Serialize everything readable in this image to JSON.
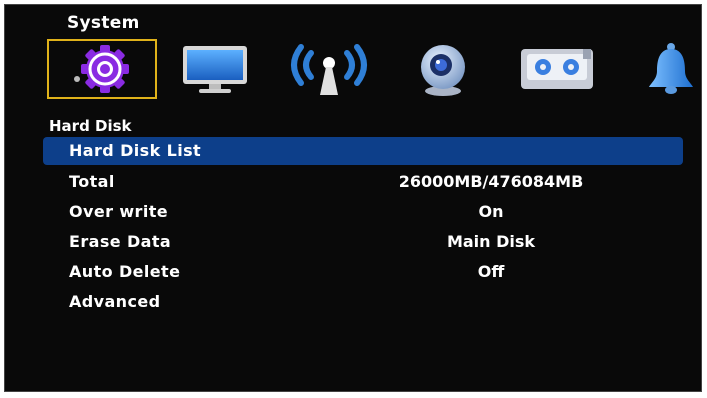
{
  "header": {
    "title": "System"
  },
  "tabs": [
    {
      "name": "system",
      "icon": "gear-icon",
      "selected": true
    },
    {
      "name": "display",
      "icon": "monitor-icon",
      "selected": false
    },
    {
      "name": "network",
      "icon": "antenna-icon",
      "selected": false
    },
    {
      "name": "camera",
      "icon": "webcam-icon",
      "selected": false
    },
    {
      "name": "recording",
      "icon": "cassette-icon",
      "selected": false
    },
    {
      "name": "alarm",
      "icon": "bell-icon",
      "selected": false
    }
  ],
  "section": {
    "label": "Hard Disk"
  },
  "menu": {
    "hard_disk_list": {
      "label": "Hard Disk List"
    },
    "total": {
      "label": "Total",
      "value": "26000MB/476084MB"
    },
    "overwrite": {
      "label": "Over write",
      "value": "On"
    },
    "erase_data": {
      "label": "Erase Data",
      "value": "Main Disk"
    },
    "auto_delete": {
      "label": "Auto Delete",
      "value": "Off"
    },
    "advanced": {
      "label": "Advanced"
    }
  },
  "colors": {
    "background": "#090909",
    "highlight": "#0d3f8a",
    "selection_border": "#e0b21a",
    "gear_purple": "#8a2be2",
    "icon_blue": "#2f7fd6"
  }
}
